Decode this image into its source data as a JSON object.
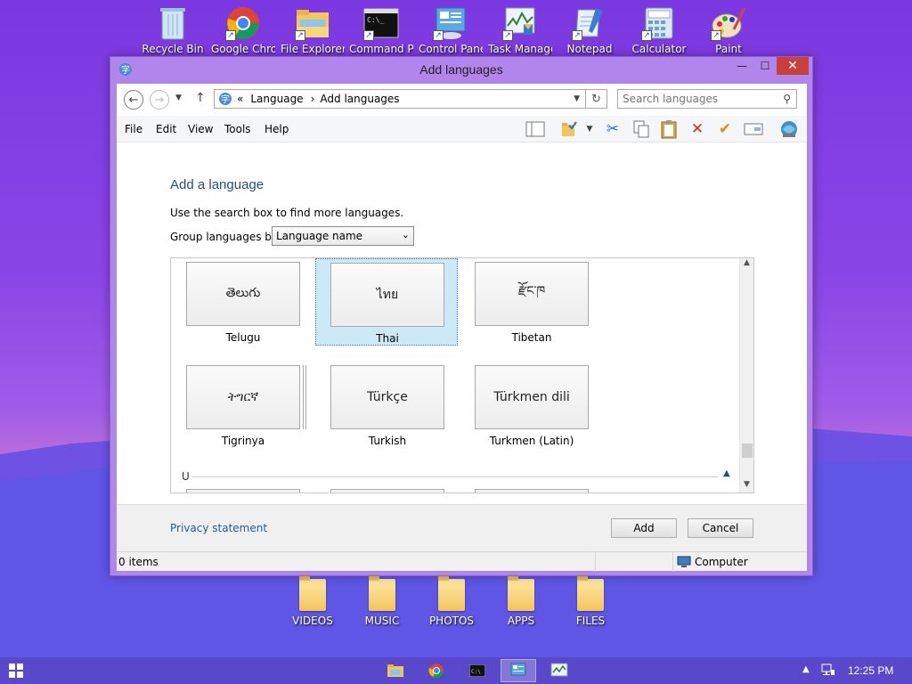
{
  "desktop": {
    "top_icons": [
      {
        "name": "recycle-bin",
        "label": "Recycle Bin"
      },
      {
        "name": "google-chrome",
        "label": "Google Chrome"
      },
      {
        "name": "file-explorer",
        "label": "File Explorer"
      },
      {
        "name": "command-prompt",
        "label": "Command Prompt"
      },
      {
        "name": "control-panel",
        "label": "Control Panel"
      },
      {
        "name": "task-manager",
        "label": "Task Manager"
      },
      {
        "name": "notepad",
        "label": "Notepad"
      },
      {
        "name": "calculator",
        "label": "Calculator"
      },
      {
        "name": "paint",
        "label": "Paint"
      }
    ],
    "folders": [
      "VIDEOS",
      "MUSIC",
      "PHOTOS",
      "APPS",
      "FILES"
    ]
  },
  "window": {
    "title": "Add languages",
    "close_glyph": "✕",
    "min_glyph": "—",
    "max_glyph": "☐"
  },
  "address": {
    "prefix": "«",
    "crumbs": [
      "Language",
      "Add languages"
    ],
    "separator": "›",
    "search_placeholder": "Search languages"
  },
  "menu": [
    "File",
    "Edit",
    "View",
    "Tools",
    "Help"
  ],
  "content": {
    "heading": "Add a language",
    "hint": "Use the search box to find more languages.",
    "group_label": "Group languages by:",
    "group_value": "Language name",
    "section_letter": "U",
    "tiles": [
      {
        "script": "తెలుగు",
        "name": "Telugu",
        "selected": false,
        "stack": false
      },
      {
        "script": "ไทย",
        "name": "Thai",
        "selected": true,
        "stack": false
      },
      {
        "script": "རྫོང་ཁ",
        "name": "Tibetan",
        "selected": false,
        "stack": false
      },
      {
        "script": "ትግርኛ",
        "name": "Tigrinya",
        "selected": false,
        "stack": true
      },
      {
        "script": "Türkçe",
        "name": "Turkish",
        "selected": false,
        "stack": false
      },
      {
        "script": "Türkmen dili",
        "name": "Turkmen (Latin)",
        "selected": false,
        "stack": false
      }
    ]
  },
  "footer": {
    "privacy": "Privacy statement",
    "add": "Add",
    "cancel": "Cancel"
  },
  "status": {
    "items": "0 items",
    "location": "Computer"
  },
  "taskbar": {
    "clock": "12:25 PM"
  }
}
